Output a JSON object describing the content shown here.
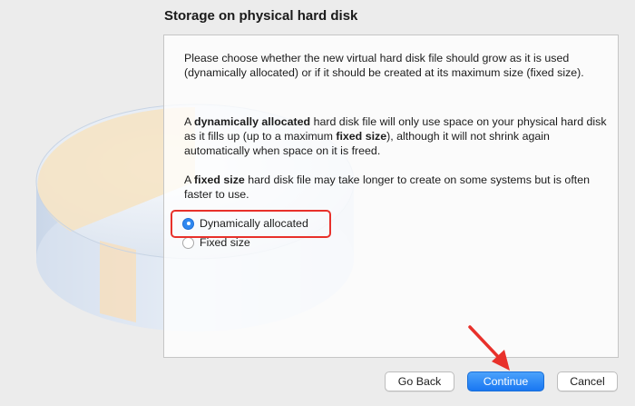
{
  "title": "Storage on physical hard disk",
  "paragraphs": {
    "intro": "Please choose whether the new virtual hard disk file should grow as it is used (dynamically allocated) or if it should be created at its maximum size (fixed size).",
    "dynamic": {
      "prefix": "A ",
      "bold": "dynamically allocated",
      "middle": " hard disk file will only use space on your physical hard disk as it fills up (up to a maximum ",
      "bold2": "fixed size",
      "suffix": "), although it will not shrink again automatically when space on it is freed."
    },
    "fixed": {
      "prefix": "A ",
      "bold": "fixed size",
      "suffix": " hard disk file may take longer to create on some systems but is often faster to use."
    }
  },
  "options": [
    {
      "label": "Dynamically allocated",
      "selected": true
    },
    {
      "label": "Fixed size",
      "selected": false
    }
  ],
  "buttons": {
    "back": "Go Back",
    "continue": "Continue",
    "cancel": "Cancel"
  },
  "colors": {
    "accent": "#1977f2",
    "annotation": "#e8312b"
  },
  "icons": {
    "background": "hard-disk-illustration",
    "annotation": "red-arrow-icon"
  }
}
